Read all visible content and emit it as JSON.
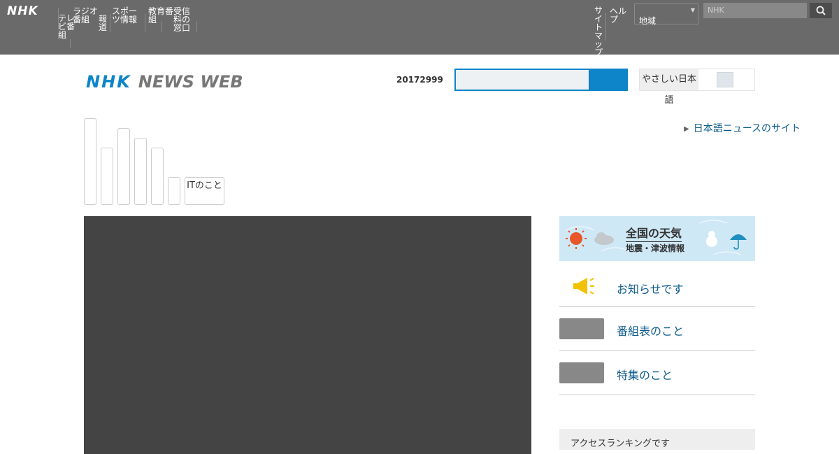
{
  "global_header": {
    "logo": "NHK",
    "nav": [
      {
        "label": "テレビ番組"
      },
      {
        "label": "ラジオ番組"
      },
      {
        "label": "報道"
      },
      {
        "label": "スポーツ情報"
      },
      {
        "label": "教育番組"
      },
      {
        "label": "受信料の窓口"
      }
    ],
    "right_links": [
      {
        "label": "サイトマップ"
      },
      {
        "label": "ヘルプ"
      }
    ],
    "region_select": "地域",
    "search_placeholder": "NHK"
  },
  "news_header": {
    "logo_brand": "NHK",
    "logo_product": "NEWS WEB",
    "date": "20172999",
    "search_value": "",
    "toggle_label": "やさしい日本語"
  },
  "category_tabs": [
    {
      "label": ""
    },
    {
      "label": ""
    },
    {
      "label": ""
    },
    {
      "label": ""
    },
    {
      "label": ""
    },
    {
      "label": ""
    },
    {
      "label": "ITのこと"
    }
  ],
  "external_link": "日本語ニュースのサイト",
  "weather_banner": {
    "title": "全国の天気",
    "subtitle": "地震・津波情報"
  },
  "right_items": [
    {
      "label": "お知らせです"
    },
    {
      "label": "番組表のこと"
    },
    {
      "label": "特集のこと"
    }
  ],
  "bottom_box": "アクセスランキングです"
}
